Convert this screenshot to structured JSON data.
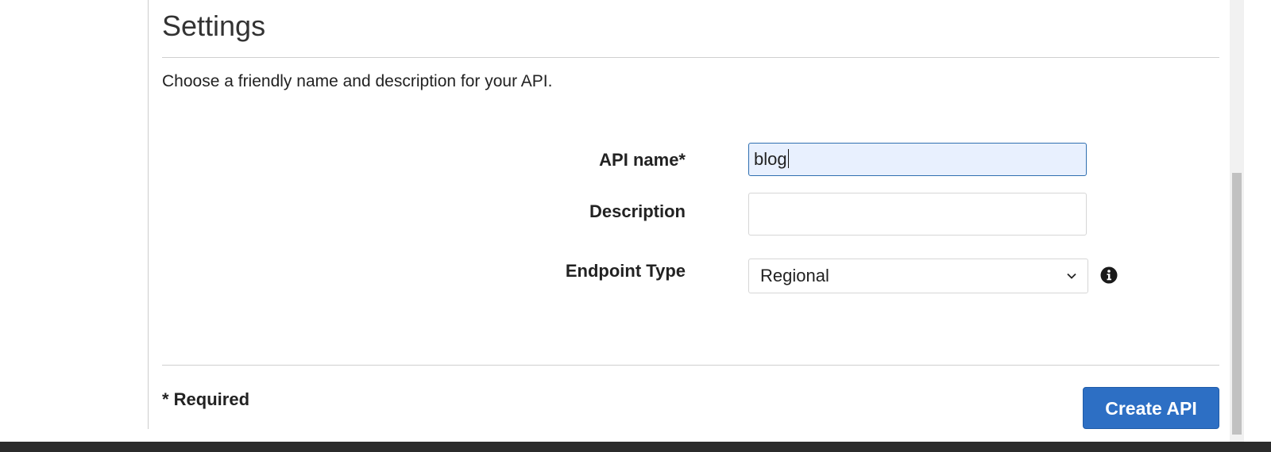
{
  "section": {
    "title": "Settings",
    "intro": "Choose a friendly name and description for your API."
  },
  "form": {
    "api_name_label": "API name*",
    "api_name_value": "blog",
    "description_label": "Description",
    "description_value": "",
    "endpoint_type_label": "Endpoint Type",
    "endpoint_type_value": "Regional"
  },
  "footer": {
    "required_note": "* Required",
    "create_button_label": "Create API"
  },
  "icons": {
    "endpoint_info": "info-icon",
    "select_chevron": "chevron-down-icon"
  },
  "colors": {
    "primary_button": "#2d6fc4",
    "focused_input_bg": "#e8f0fe",
    "focused_input_border": "#2f6fb0"
  }
}
